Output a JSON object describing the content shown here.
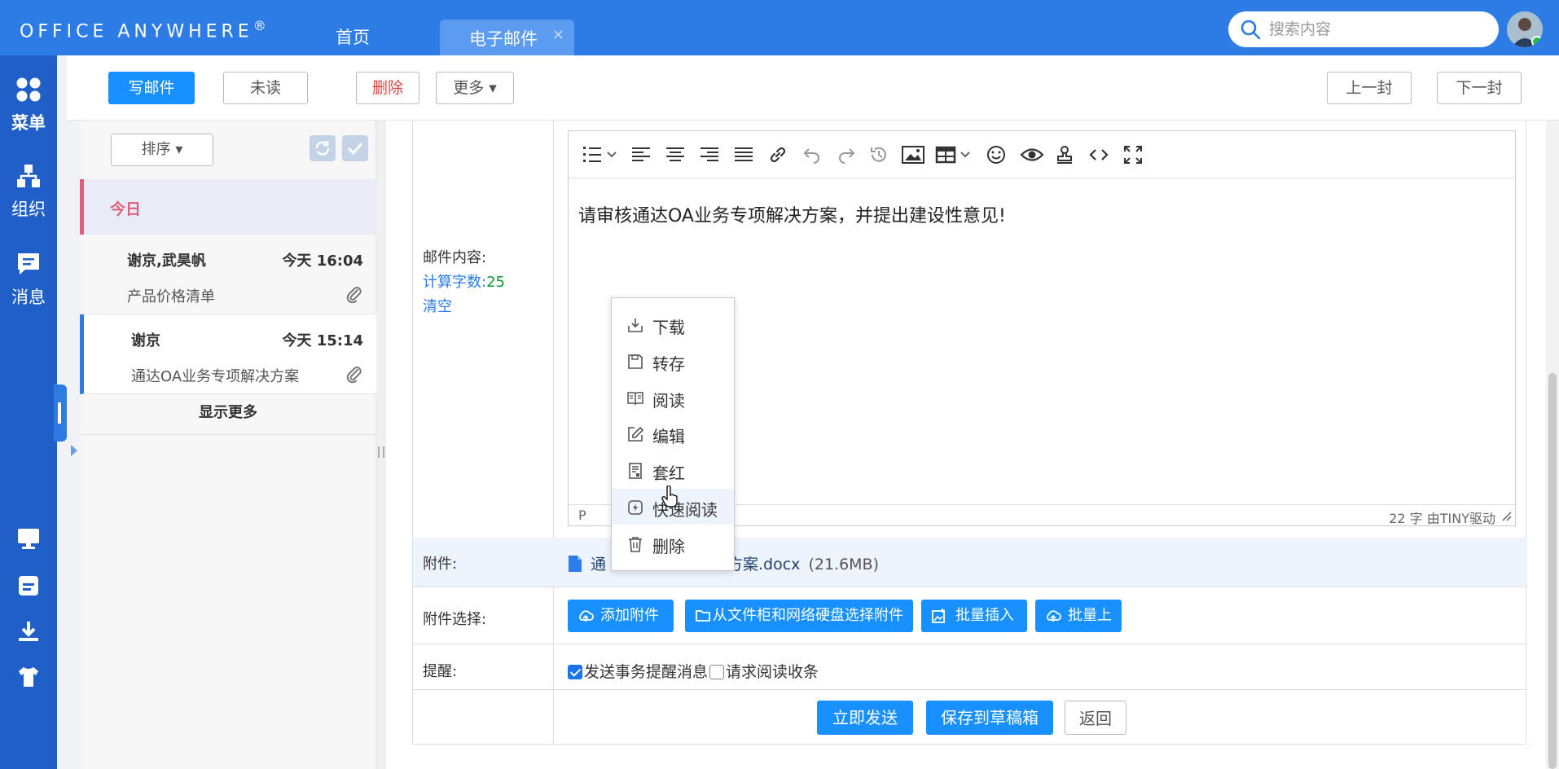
{
  "app": {
    "brand": "Office Anywhere",
    "brand_mark": "®",
    "tabs": [
      {
        "label": "首页"
      },
      {
        "label": "电子邮件",
        "close": "×"
      }
    ],
    "search_placeholder": "搜索内容"
  },
  "leftnav": {
    "items": [
      {
        "label": "菜单",
        "icon": "grid-icon"
      },
      {
        "label": "组织",
        "icon": "org-icon"
      },
      {
        "label": "消息",
        "icon": "message-icon"
      }
    ],
    "bottom_icons": [
      "monitor-icon",
      "note-icon",
      "download-icon",
      "shirt-icon",
      "more-pill-icon"
    ]
  },
  "toolbar": {
    "compose": "写邮件",
    "unread": "未读",
    "delete": "删除",
    "more": "更多",
    "prev": "上一封",
    "next": "下一封"
  },
  "maillist": {
    "sort": "排序",
    "group_today": "今日",
    "mails": [
      {
        "from": "谢京,武昊帆",
        "time": "今天 16:04",
        "subject": "产品价格清单",
        "has_attachment": true
      },
      {
        "from": "谢京",
        "time": "今天 15:14",
        "subject": "通达OA业务专项解决方案",
        "has_attachment": true
      }
    ],
    "show_more": "显示更多"
  },
  "form": {
    "content_label": "邮件内容:",
    "count_label": "计算字数:",
    "count_value": "25",
    "clear": "清空",
    "editor_text": "请审核通达OA业务专项解决方案，并提出建设性意见!",
    "editor_status_left": "P",
    "editor_status_right": "22 字  由TINY驱动",
    "attach_label": "附件:",
    "attach_file_left": "通",
    "attach_file_right": "辑方案.docx",
    "attach_size": "(21.6MB)",
    "attach_select_label": "附件选择:",
    "btn_add": "添加附件",
    "btn_cabinet": "从文件柜和网络硬盘选择附件",
    "btn_batch_img": "批量插入图片",
    "btn_batch_upload": "批量上传",
    "remind_label": "提醒:",
    "chk_remind": "发送事务提醒消息",
    "chk_receipt": "请求阅读收条",
    "btn_send": "立即发送",
    "btn_draft": "保存到草稿箱",
    "btn_back": "返回"
  },
  "context_menu": {
    "items": [
      {
        "label": "下载",
        "icon": "download-icon"
      },
      {
        "label": "转存",
        "icon": "save-icon"
      },
      {
        "label": "阅读",
        "icon": "book-icon"
      },
      {
        "label": "编辑",
        "icon": "edit-icon"
      },
      {
        "label": "套红",
        "icon": "doc-red-icon"
      },
      {
        "label": "快速阅读",
        "icon": "quick-read-icon"
      },
      {
        "label": "删除",
        "icon": "trash-icon"
      }
    ]
  },
  "colors": {
    "header": "#2d7be5",
    "nav": "#1f5fc7",
    "primary": "#1890ff",
    "danger": "#e04141",
    "today": "#e0607a"
  }
}
